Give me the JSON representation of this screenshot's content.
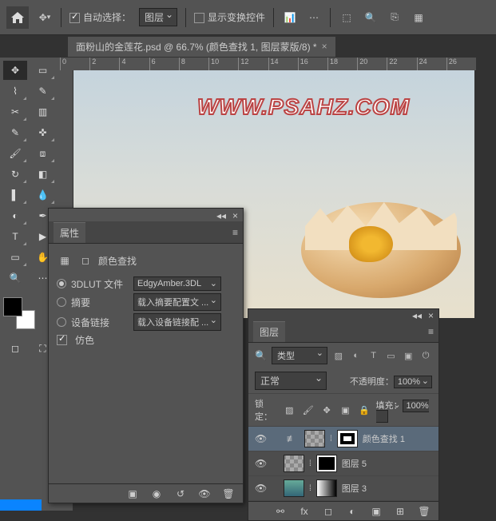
{
  "topbar": {
    "auto_select": "自动选择：",
    "target": "图层",
    "show_transform": "显示变换控件"
  },
  "tab": {
    "title": "面粉山的金莲花.psd @ 66.7% (颜色查找 1, 图层蒙版/8) *"
  },
  "ruler_marks": [
    "0",
    "2",
    "4",
    "6",
    "8",
    "10",
    "12",
    "14",
    "16",
    "18",
    "20",
    "22",
    "24",
    "26"
  ],
  "watermark": "WWW.PSAHZ.COM",
  "props": {
    "title": "属性",
    "type": "颜色查找",
    "r_3dlut": "3DLUT 文件",
    "r_abstract": "摘要",
    "r_devlink": "设备链接",
    "c_dither": "仿色",
    "v_3dlut": "EdgyAmber.3DL",
    "v_abstract": "载入摘要配置文 ...",
    "v_devlink": "载入设备链接配 ..."
  },
  "layers_panel": {
    "title": "图层",
    "filter_kind": "类型",
    "blend": "正常",
    "opacity_lbl": "不透明度：",
    "opacity": "100%",
    "lock_lbl": "锁定：",
    "fill_lbl": "填充：",
    "fill": "100%",
    "items": [
      {
        "name": "颜色查找 1",
        "active": true
      },
      {
        "name": "图层 5",
        "active": false
      },
      {
        "name": "图层 3",
        "active": false
      }
    ]
  }
}
